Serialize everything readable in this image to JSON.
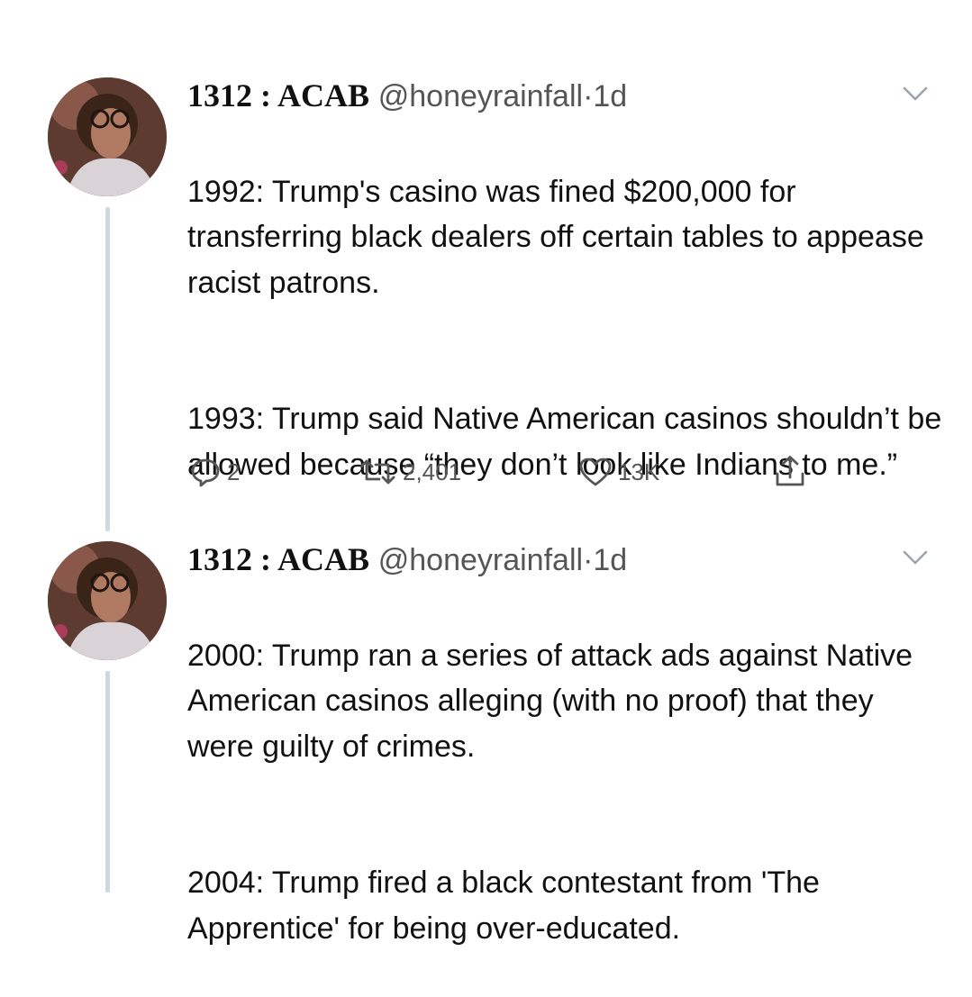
{
  "tweets": [
    {
      "display_name": "1312 : ACAB",
      "handle": "@honeyrainfall",
      "separator": "·",
      "time": "1d",
      "paragraphs": [
        "1992: Trump's casino was fined $200,000 for transferring black dealers off certain tables to appease racist patrons.",
        "1993: Trump said Native American casinos shouldn’t be allowed because “they don’t look like Indians to me.”"
      ],
      "actions": {
        "reply_count": "2",
        "retweet_count": "2,401",
        "like_count": "13K"
      }
    },
    {
      "display_name": "1312 : ACAB",
      "handle": "@honeyrainfall",
      "separator": "·",
      "time": "1d",
      "paragraphs": [
        "2000: Trump ran a series of attack ads against Native American casinos alleging (with no proof) that they were guilty of crimes.",
        "2004: Trump fired a black contestant from 'The Apprentice' for being over-educated."
      ]
    }
  ],
  "colors": {
    "text": "#111111",
    "secondary": "#555555",
    "thread_line": "#cfd9de",
    "background": "#ffffff"
  },
  "icons": {
    "reply": "speech-bubble-icon",
    "retweet": "retweet-arrows-icon",
    "like": "heart-icon",
    "share": "share-upload-icon",
    "menu": "chevron-down-icon"
  }
}
